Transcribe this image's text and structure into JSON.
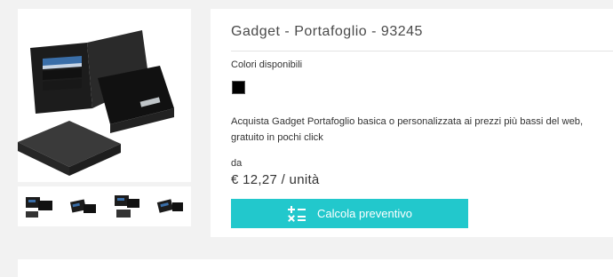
{
  "product": {
    "title": "Gadget - Portafoglio - 93245",
    "colors_label": "Colori disponibili",
    "swatch_color": "#000000",
    "description_lines": [
      "Acquista Gadget Portafoglio basica o personalizzata ai prezzi più bassi del web,",
      "gratuito in pochi click"
    ],
    "from_label": "da",
    "price": "€ 12,27 / unità",
    "cta_label": "Calcola preventivo",
    "cta_icon": "calculator-icon",
    "accent_color": "#22c8cc"
  },
  "gallery": {
    "main_image": "wallet-with-box-image",
    "thumbnails": [
      "wallet-thumbnail-1",
      "wallet-thumbnail-2",
      "wallet-thumbnail-3",
      "wallet-thumbnail-4"
    ]
  }
}
